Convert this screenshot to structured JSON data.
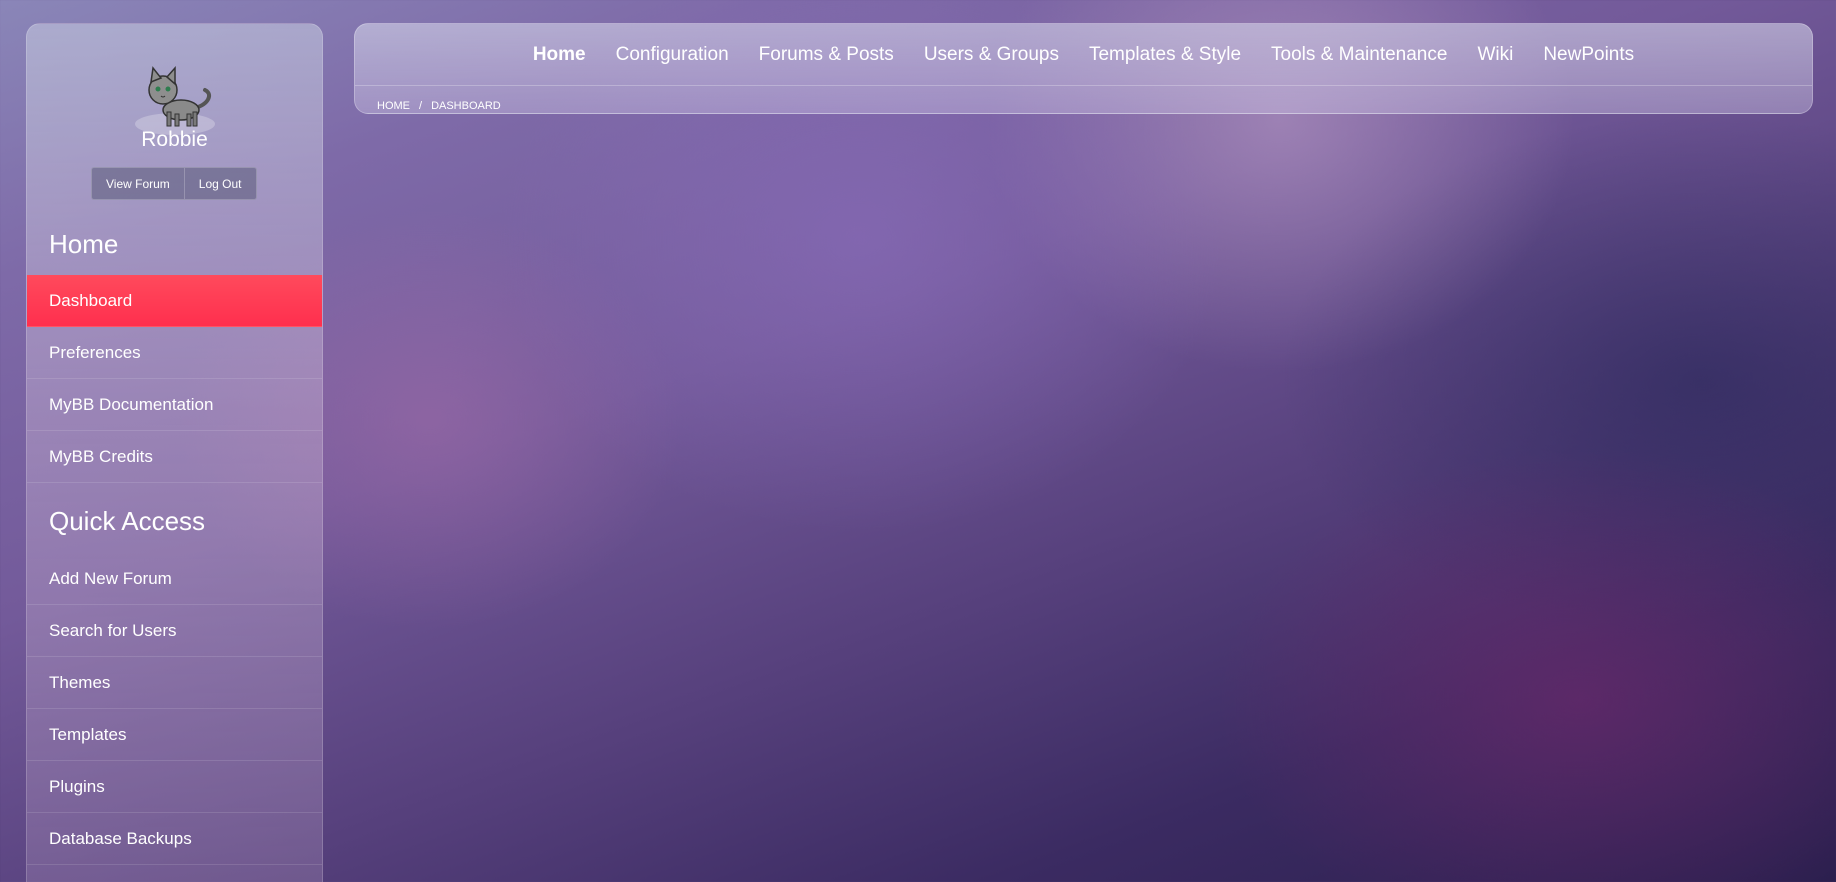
{
  "user": {
    "name": "Robbie",
    "view_forum_label": "View Forum",
    "log_out_label": "Log Out"
  },
  "sidebar": {
    "home_heading": "Home",
    "home_items": [
      {
        "label": "Dashboard",
        "active": true
      },
      {
        "label": "Preferences"
      },
      {
        "label": "MyBB Documentation"
      },
      {
        "label": "MyBB Credits"
      }
    ],
    "quick_access_heading": "Quick Access",
    "quick_access_items": [
      {
        "label": "Add New Forum"
      },
      {
        "label": "Search for Users"
      },
      {
        "label": "Themes"
      },
      {
        "label": "Templates"
      },
      {
        "label": "Plugins"
      },
      {
        "label": "Database Backups"
      }
    ]
  },
  "nav": {
    "items": [
      {
        "label": "Home",
        "active": true
      },
      {
        "label": "Configuration"
      },
      {
        "label": "Forums & Posts"
      },
      {
        "label": "Users & Groups"
      },
      {
        "label": "Templates & Style"
      },
      {
        "label": "Tools & Maintenance"
      },
      {
        "label": "Wiki"
      },
      {
        "label": "NewPoints"
      }
    ]
  },
  "breadcrumb": {
    "home": "Home",
    "separator": "/",
    "current": "Dashboard"
  },
  "colors": {
    "active_item": "#ff3a54"
  },
  "icons": {
    "avatar": "cat-avatar-icon"
  }
}
